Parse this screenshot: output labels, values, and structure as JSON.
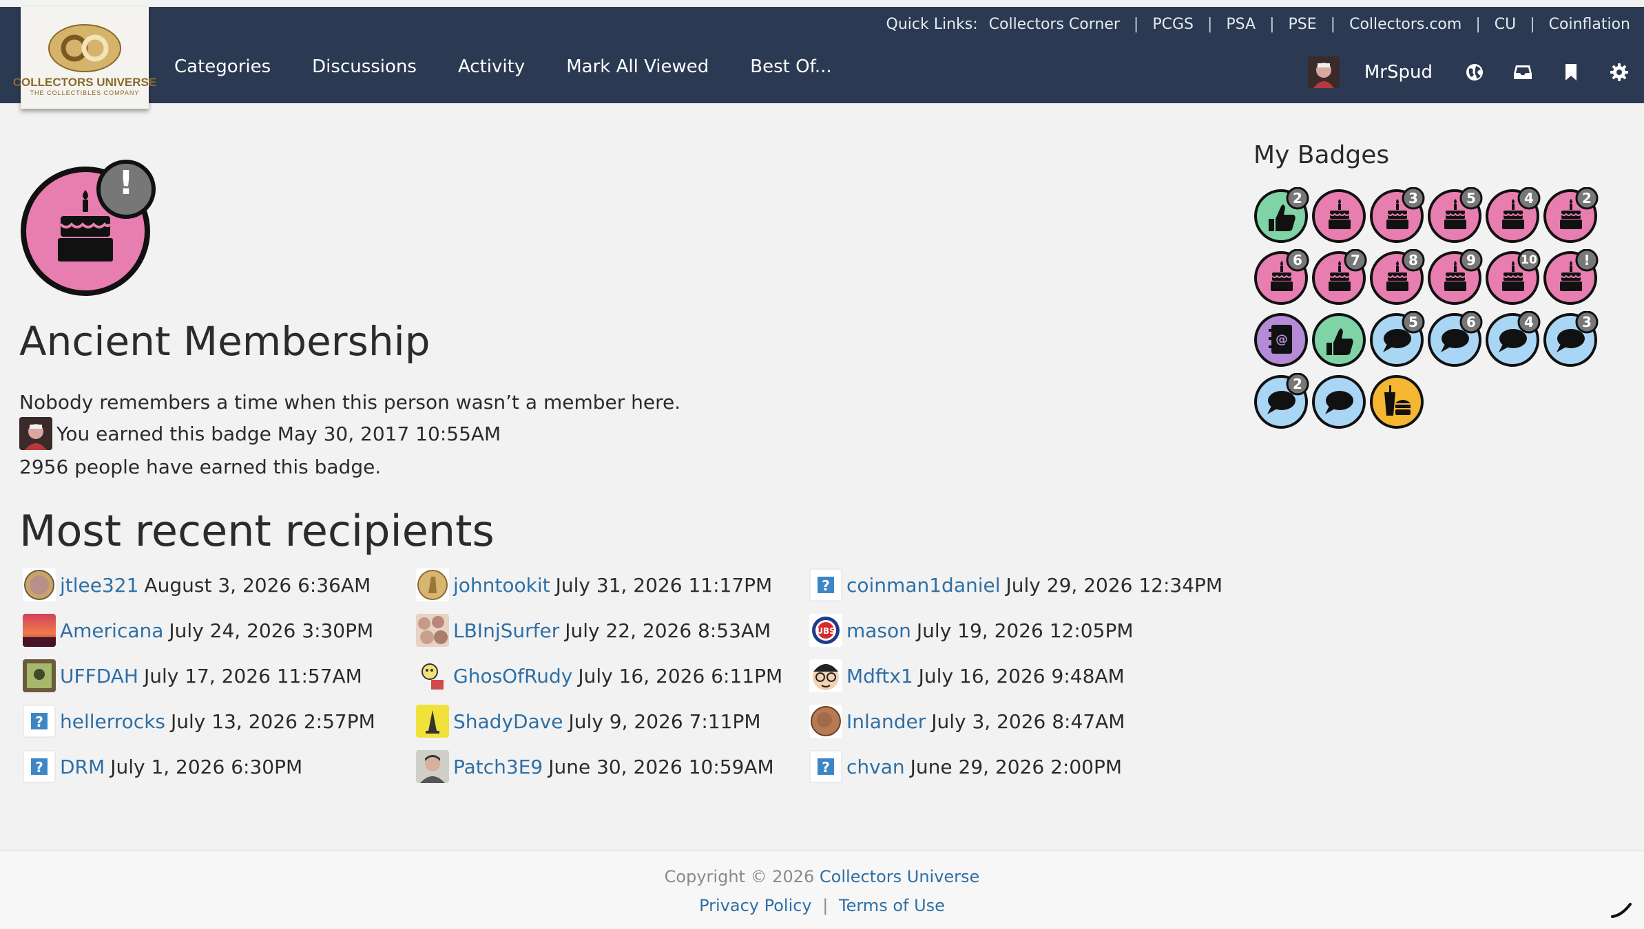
{
  "header": {
    "logo_text": "COLLECTORS UNIVERSE",
    "logo_sub": "THE COLLECTIBLES COMPANY",
    "quick_links_label": "Quick Links:",
    "quick_links": [
      "Collectors Corner",
      "PCGS",
      "PSA",
      "PSE",
      "Collectors.com",
      "CU",
      "Coinflation"
    ],
    "separator": "|",
    "nav": [
      "Categories",
      "Discussions",
      "Activity",
      "Mark All Viewed",
      "Best Of..."
    ],
    "username": "MrSpud",
    "icons": [
      "globe-icon",
      "inbox-icon",
      "bookmark-icon",
      "gear-icon"
    ]
  },
  "badge": {
    "icon": "birthday-cake-icon",
    "overlay": "!",
    "title": "Ancient Membership",
    "description": "Nobody remembers a time when this person wasn’t a member here.",
    "earned_text": "You earned this badge May 30, 2017 10:55AM",
    "earned_count_text": "2956 people have earned this badge."
  },
  "recent": {
    "title": "Most recent recipients",
    "recipients": [
      {
        "name": "jtlee321",
        "date": "August 3, 2026 6:36AM",
        "avatar": "coin"
      },
      {
        "name": "johntookit",
        "date": "July 31, 2026 11:17PM",
        "avatar": "gold-coin"
      },
      {
        "name": "coinman1daniel",
        "date": "July 29, 2026 12:34PM",
        "avatar": "placeholder"
      },
      {
        "name": "Americana",
        "date": "July 24, 2026 3:30PM",
        "avatar": "sunset"
      },
      {
        "name": "LBInjSurfer",
        "date": "July 22, 2026 8:53AM",
        "avatar": "stones"
      },
      {
        "name": "mason",
        "date": "July 19, 2026 12:05PM",
        "avatar": "cubs"
      },
      {
        "name": "UFFDAH",
        "date": "July 17, 2026 11:57AM",
        "avatar": "stamp"
      },
      {
        "name": "GhosOfRudy",
        "date": "July 16, 2026 6:11PM",
        "avatar": "cartoon"
      },
      {
        "name": "Mdftx1",
        "date": "July 16, 2026 9:48AM",
        "avatar": "glasses-face"
      },
      {
        "name": "hellerrocks",
        "date": "July 13, 2026 2:57PM",
        "avatar": "placeholder"
      },
      {
        "name": "ShadyDave",
        "date": "July 9, 2026 7:11PM",
        "avatar": "yellow-flag"
      },
      {
        "name": "Inlander",
        "date": "July 3, 2026 8:47AM",
        "avatar": "copper-coin"
      },
      {
        "name": "DRM",
        "date": "July 1, 2026 6:30PM",
        "avatar": "placeholder"
      },
      {
        "name": "Patch3E9",
        "date": "June 30, 2026 10:59AM",
        "avatar": "portrait"
      },
      {
        "name": "chvan",
        "date": "June 29, 2026 2:00PM",
        "avatar": "placeholder"
      }
    ]
  },
  "my_badges": {
    "title": "My Badges",
    "items": [
      {
        "icon": "thumbs-up-icon",
        "color": "#7fd3a6",
        "count": "2"
      },
      {
        "icon": "birthday-cake-icon",
        "color": "#e87db0",
        "count": ""
      },
      {
        "icon": "birthday-cake-icon",
        "color": "#e87db0",
        "count": "3"
      },
      {
        "icon": "birthday-cake-icon",
        "color": "#e87db0",
        "count": "5"
      },
      {
        "icon": "birthday-cake-icon",
        "color": "#e87db0",
        "count": "4"
      },
      {
        "icon": "birthday-cake-icon",
        "color": "#e87db0",
        "count": "2"
      },
      {
        "icon": "birthday-cake-icon",
        "color": "#e87db0",
        "count": "6"
      },
      {
        "icon": "birthday-cake-icon",
        "color": "#e87db0",
        "count": "7"
      },
      {
        "icon": "birthday-cake-icon",
        "color": "#e87db0",
        "count": "8"
      },
      {
        "icon": "birthday-cake-icon",
        "color": "#e87db0",
        "count": "9"
      },
      {
        "icon": "birthday-cake-icon",
        "color": "#e87db0",
        "count": "10"
      },
      {
        "icon": "birthday-cake-icon",
        "color": "#e87db0",
        "count": "!"
      },
      {
        "icon": "address-book-icon",
        "color": "#b58ad6",
        "count": ""
      },
      {
        "icon": "thumbs-up-icon",
        "color": "#7fd3a6",
        "count": ""
      },
      {
        "icon": "comment-icon",
        "color": "#a9d6f5",
        "count": "5"
      },
      {
        "icon": "comment-icon",
        "color": "#a9d6f5",
        "count": "6"
      },
      {
        "icon": "comment-icon",
        "color": "#a9d6f5",
        "count": "4"
      },
      {
        "icon": "comment-icon",
        "color": "#a9d6f5",
        "count": "3"
      },
      {
        "icon": "comment-icon",
        "color": "#a9d6f5",
        "count": "2"
      },
      {
        "icon": "comment-icon",
        "color": "#a9d6f5",
        "count": ""
      },
      {
        "icon": "burger-drink-icon",
        "color": "#f5b731",
        "count": ""
      }
    ]
  },
  "footer": {
    "copyright_prefix": "Copyright © 2026",
    "copyright_link": "Collectors Universe",
    "privacy": "Privacy Policy",
    "separator": "|",
    "terms": "Terms of Use"
  },
  "colors": {
    "header_bg": "#2b3a52",
    "link": "#2e6fa6",
    "cake_badge": "#e87db0",
    "overlay_badge": "#777777"
  }
}
